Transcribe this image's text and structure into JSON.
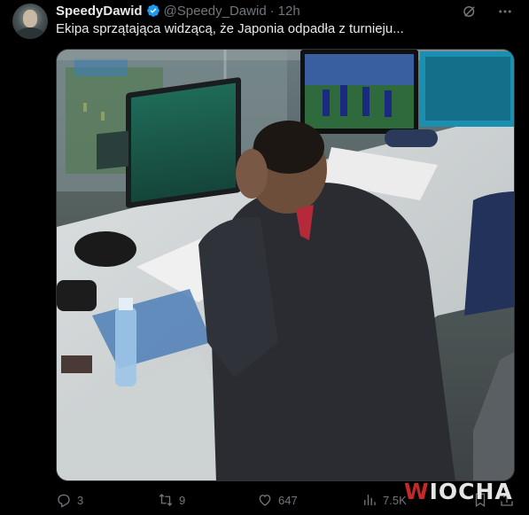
{
  "tweet": {
    "display_name": "SpeedyDawid",
    "handle": "@Speedy_Dawid",
    "separator": "·",
    "time": "12h",
    "text": "Ekipa sprzątająca widzącą, że Japonia odpadła z turnieju...",
    "verified": true
  },
  "media": {
    "alt": "Photo of a man in a dark suit sitting at a press desk with his head in his hands, monitors showing football match"
  },
  "actions": {
    "replies": "3",
    "reposts": "9",
    "likes": "647",
    "views": "7.5K"
  },
  "watermark": {
    "prefix": "W",
    "text": "IOCHA"
  },
  "colors": {
    "background": "#000000",
    "text": "#e7e9ea",
    "secondary": "#71767b",
    "verified": "#1d9bf0",
    "watermark_accent": "#c62828"
  }
}
